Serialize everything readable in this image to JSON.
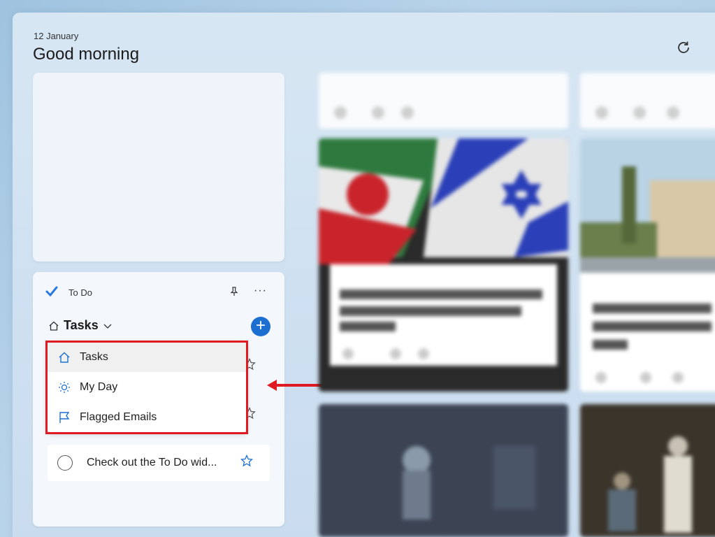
{
  "header": {
    "date": "12 January",
    "greeting": "Good morning"
  },
  "todo": {
    "title": "To Do",
    "list_name": "Tasks",
    "dropdown": {
      "items": [
        {
          "label": "Tasks",
          "icon": "home-icon"
        },
        {
          "label": "My Day",
          "icon": "sun-icon"
        },
        {
          "label": "Flagged Emails",
          "icon": "flag-icon"
        }
      ]
    },
    "task": {
      "text": "Check out the To Do wid..."
    }
  },
  "colors": {
    "accent": "#1c6fd1",
    "annotation": "#e01a22"
  }
}
